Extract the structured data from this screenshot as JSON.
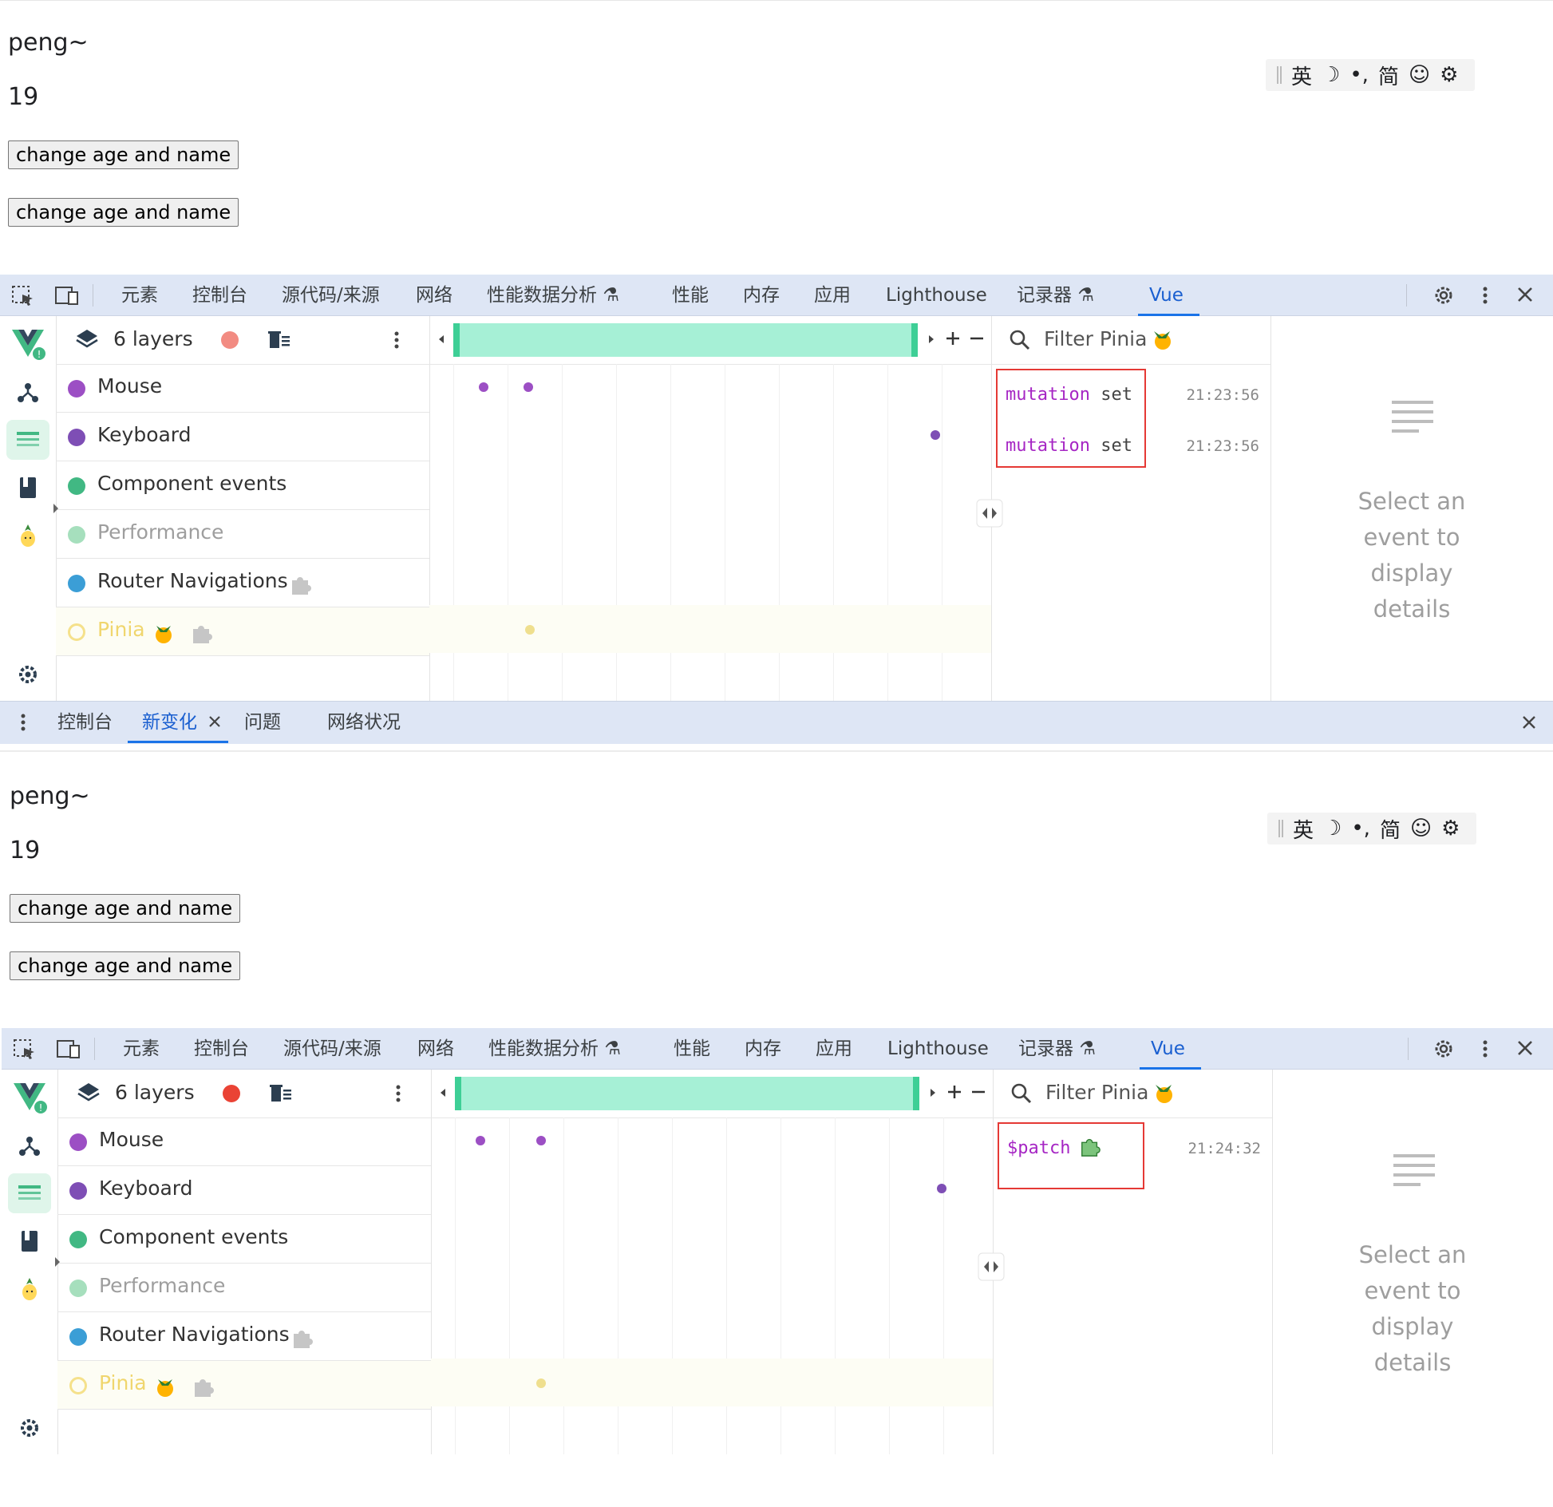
{
  "shots": [
    {
      "app": {
        "name": "peng~",
        "age": "19",
        "button1": "change age and name",
        "button2": "change age and name"
      },
      "ime": {
        "items": [
          "英",
          "☽",
          "•,",
          "简",
          "☺",
          "⚙"
        ]
      },
      "devtools": {
        "tabs": [
          "元素",
          "控制台",
          "源代码/来源",
          "网络",
          "性能数据分析",
          "性能",
          "内存",
          "应用",
          "Lighthouse",
          "记录器",
          "Vue"
        ],
        "active_tab": "Vue"
      },
      "layers": {
        "count_label": "6 layers",
        "items": [
          {
            "label": "Mouse",
            "color": "#9c4fc4"
          },
          {
            "label": "Keyboard",
            "color": "#7e4eb5"
          },
          {
            "label": "Component events",
            "color": "#41b883"
          },
          {
            "label": "Performance",
            "color": "#a6dfbd"
          },
          {
            "label": "Router Navigations",
            "color": "#3b9ed6"
          },
          {
            "label": "Pinia",
            "color": "#f5e18b"
          }
        ]
      },
      "timeline": {
        "filter": "Filter Pinia"
      },
      "events": [
        {
          "title": "mutation",
          "sub": "set",
          "time": "21:23:56"
        },
        {
          "title": "mutation",
          "sub": "set",
          "time": "21:23:56"
        }
      ],
      "details": {
        "empty_text": "Select an event to display details"
      },
      "drawer": {
        "tabs": [
          "控制台",
          "新变化",
          "问题",
          "网络状况"
        ],
        "active": "新变化"
      }
    },
    {
      "app": {
        "name": "peng~",
        "age": "19",
        "button1": "change age and name",
        "button2": "change age and name"
      },
      "ime": {
        "items": [
          "英",
          "☽",
          "•,",
          "简",
          "☺",
          "⚙"
        ]
      },
      "devtools": {
        "tabs": [
          "元素",
          "控制台",
          "源代码/来源",
          "网络",
          "性能数据分析",
          "性能",
          "内存",
          "应用",
          "Lighthouse",
          "记录器",
          "Vue"
        ],
        "active_tab": "Vue"
      },
      "layers": {
        "count_label": "6 layers",
        "items": [
          {
            "label": "Mouse",
            "color": "#9c4fc4"
          },
          {
            "label": "Keyboard",
            "color": "#7e4eb5"
          },
          {
            "label": "Component events",
            "color": "#41b883"
          },
          {
            "label": "Performance",
            "color": "#a6dfbd"
          },
          {
            "label": "Router Navigations",
            "color": "#3b9ed6"
          },
          {
            "label": "Pinia",
            "color": "#f5e18b"
          }
        ]
      },
      "timeline": {
        "filter": "Filter Pinia"
      },
      "events": [
        {
          "title": "$patch",
          "sub": "",
          "time": "21:24:32"
        }
      ],
      "details": {
        "empty_text": "Select an event to display details"
      }
    }
  ]
}
